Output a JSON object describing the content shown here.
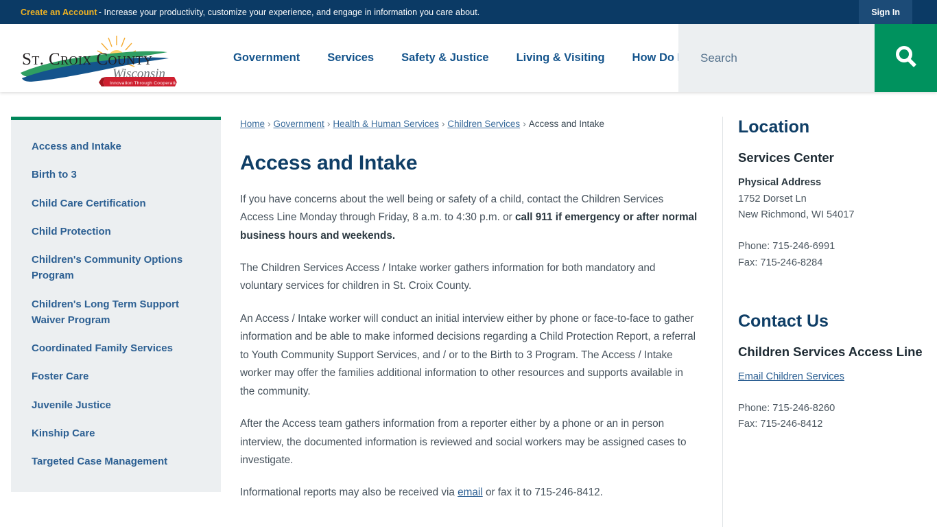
{
  "alert_bar": {
    "create_account_label": "Create an Account",
    "message": " - Increase your productivity, customize your experience, and engage in information you care about.",
    "sign_in_label": "Sign In",
    "bg_color": "#0b3a65",
    "accent_color": "#f0b323"
  },
  "header": {
    "logo": {
      "name": "st-croix-county-logo",
      "line1": "ST. CROIX COUNTY",
      "line2": "Wisconsin",
      "ribbon_text": "Innovation Through Cooperation"
    },
    "nav": [
      {
        "label": "Government"
      },
      {
        "label": "Services"
      },
      {
        "label": "Safety & Justice"
      },
      {
        "label": "Living & Visiting"
      },
      {
        "label": "How Do I..."
      }
    ],
    "search": {
      "placeholder": "Search",
      "value": "",
      "icon": "search-icon",
      "button_color": "#00925e"
    }
  },
  "sidebar": {
    "accent_color": "#00875a",
    "items": [
      {
        "label": "Access and Intake"
      },
      {
        "label": "Birth to 3"
      },
      {
        "label": "Child Care Certification"
      },
      {
        "label": "Child Protection"
      },
      {
        "label": "Children's Community Options Program"
      },
      {
        "label": "Children's Long Term Support Waiver Program"
      },
      {
        "label": "Coordinated Family Services"
      },
      {
        "label": "Foster Care"
      },
      {
        "label": "Juvenile Justice"
      },
      {
        "label": "Kinship Care"
      },
      {
        "label": "Targeted Case Management"
      }
    ]
  },
  "breadcrumb": {
    "items": [
      {
        "label": "Home",
        "link": true
      },
      {
        "label": "Government",
        "link": true
      },
      {
        "label": "Health & Human Services",
        "link": true
      },
      {
        "label": "Children Services",
        "link": true
      },
      {
        "label": "Access and Intake",
        "link": false
      }
    ],
    "separator": "›"
  },
  "main": {
    "title": "Access and Intake",
    "paragraphs": [
      {
        "parts": [
          {
            "text": "If you have concerns about the well being or safety of a child, contact the Children Services Access Line Monday through Friday, 8 a.m. to 4:30 p.m. or ",
            "style": "normal"
          },
          {
            "text": "call 911 if emergency or after normal business hours and weekends.",
            "style": "bold"
          }
        ]
      },
      {
        "parts": [
          {
            "text": "The Children Services Access / Intake worker gathers information for both mandatory and voluntary services for children in St. Croix County.",
            "style": "normal"
          }
        ]
      },
      {
        "parts": [
          {
            "text": "An Access / Intake worker will conduct an initial interview either by phone or face-to-face to gather information and be able to make informed decisions regarding a Child Protection Report, a referral to Youth Community Support Services, and / or to the Birth to 3 Program. The Access / Intake worker may offer the families additional information to other resources and supports available in the community.",
            "style": "normal"
          }
        ]
      },
      {
        "parts": [
          {
            "text": "After the Access team gathers information from a reporter either by a phone or an in person interview, the documented information is reviewed and social workers may be assigned cases to investigate.",
            "style": "normal"
          }
        ]
      },
      {
        "parts": [
          {
            "text": "Informational reports may also be received via ",
            "style": "normal"
          },
          {
            "text": "email",
            "style": "link"
          },
          {
            "text": " or fax it to 715-246-8412.",
            "style": "normal"
          }
        ]
      }
    ]
  },
  "rail": {
    "location": {
      "heading": "Location",
      "facility": "Services Center",
      "address_label": "Physical Address",
      "street": "1752 Dorset Ln",
      "city_state_zip": "New Richmond, WI 54017",
      "phone": "Phone: 715-246-6991",
      "fax": "Fax: 715-246-8284"
    },
    "contact": {
      "heading": "Contact Us",
      "name": "Children Services Access Line",
      "email_link": "Email Children Services",
      "phone": "Phone: 715-246-8260",
      "fax": "Fax: 715-246-8412"
    }
  }
}
